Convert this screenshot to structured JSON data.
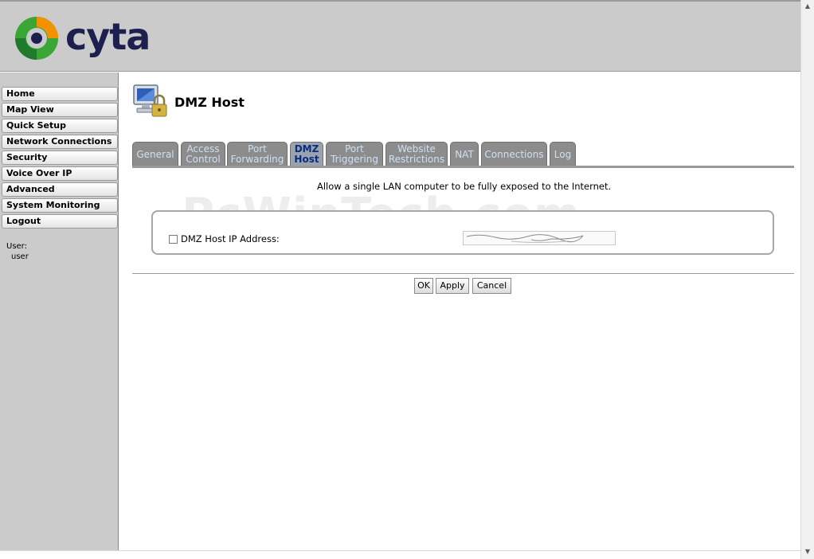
{
  "brand": {
    "name": "cyta"
  },
  "sidebar": {
    "items": [
      {
        "label": "Home"
      },
      {
        "label": "Map View"
      },
      {
        "label": "Quick Setup"
      },
      {
        "label": "Network Connections"
      },
      {
        "label": "Security"
      },
      {
        "label": "Voice Over IP"
      },
      {
        "label": "Advanced"
      },
      {
        "label": "System Monitoring"
      },
      {
        "label": "Logout"
      }
    ],
    "user_label": "User:",
    "user_name": "user"
  },
  "page": {
    "title": "DMZ Host",
    "description": "Allow a single LAN computer to be fully exposed to the Internet.",
    "watermark": "PcWinTech.com"
  },
  "tabs": [
    {
      "line1": "General",
      "line2": ""
    },
    {
      "line1": "Access",
      "line2": "Control"
    },
    {
      "line1": "Port",
      "line2": "Forwarding"
    },
    {
      "line1": "DMZ",
      "line2": "Host"
    },
    {
      "line1": "Port",
      "line2": "Triggering"
    },
    {
      "line1": "Website",
      "line2": "Restrictions"
    },
    {
      "line1": "NAT",
      "line2": ""
    },
    {
      "line1": "Connections",
      "line2": ""
    },
    {
      "line1": "Log",
      "line2": ""
    }
  ],
  "form": {
    "dmz_label": "DMZ Host IP Address:",
    "dmz_checked": false
  },
  "buttons": {
    "ok": "OK",
    "apply": "Apply",
    "cancel": "Cancel"
  },
  "colors": {
    "chrome_gray": "#cbcbcb",
    "tab_gray": "#8c8c8c",
    "tab_text": "#cfe0f5",
    "active_tab_text": "#0a2b80",
    "logo_navy": "#1d1f4f",
    "logo_green": "#3aa635",
    "logo_orange": "#f39200"
  },
  "icons": {
    "logo": "cyta-swirl-icon",
    "page": "computer-lock-icon",
    "scroll_up": "arrow-up-icon",
    "scroll_down": "arrow-down-icon"
  }
}
